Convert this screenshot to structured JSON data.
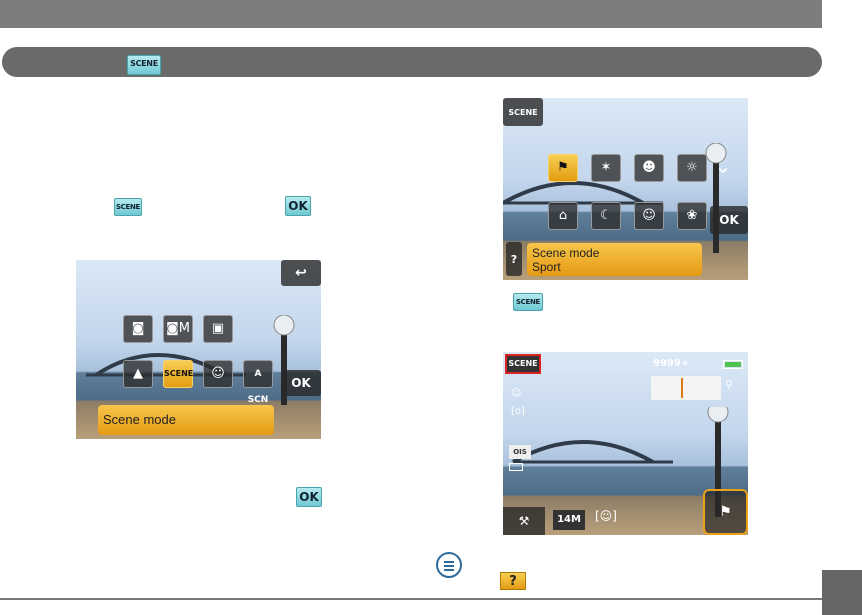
{
  "section": {
    "scene_chip": "SCENE"
  },
  "inline_icons": {
    "scene_chip": "SCENE",
    "ok_label": "OK"
  },
  "screen_a": {
    "back_icon": "back-arrow-icon",
    "modes": [
      "camera-icon",
      "camera-manual-icon",
      "video-camera-icon",
      "landscape-icon",
      "SCENE",
      "portrait-icon",
      "A SCN"
    ],
    "ok_label": "OK",
    "banner": "Scene mode"
  },
  "screen_b": {
    "scene_chip": "SCENE",
    "scene_icons_row1": [
      "sport-icon",
      "fireworks-icon",
      "child-icon",
      "sunset-icon"
    ],
    "scene_icons_row2": [
      "museum-icon",
      "night-landscape-icon",
      "night-portrait-icon",
      "landscape-icon"
    ],
    "ok_label": "OK",
    "help_label": "?",
    "banner_line1": "Scene mode",
    "banner_line2": "Sport",
    "caption_chip": "SCENE"
  },
  "screen_c": {
    "scene_chip": "SCENE",
    "shot_count": "9999+",
    "battery": "battery-full-icon",
    "left_icons": [
      "face-detect-icon",
      "metering-icon",
      "OIS",
      "aspect-icon"
    ],
    "bottom_icons": [
      "settings-icon",
      "14M",
      "face-frame-icon",
      "sport-icon"
    ]
  },
  "footer": {
    "help_label": "?"
  },
  "colors": {
    "header": "#7d7d7d",
    "bar": "#6a6a6a",
    "accent": "#e9a21a",
    "chip": "#8fdbe2"
  }
}
